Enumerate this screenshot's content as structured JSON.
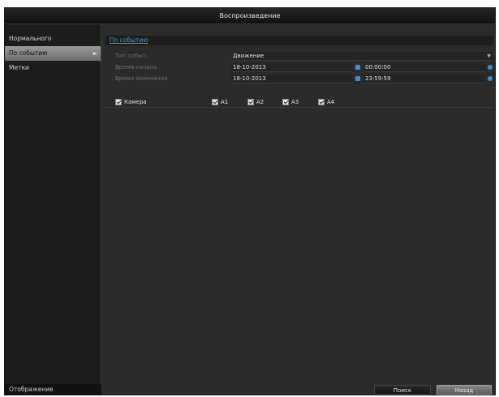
{
  "window": {
    "title": "Воспроизведение"
  },
  "sidebar": {
    "items": [
      {
        "label": "Нормального"
      },
      {
        "label": "По событию",
        "arrow": "►"
      },
      {
        "label": "Метки"
      }
    ],
    "footer": "Отображение"
  },
  "section": {
    "tab": "По событию"
  },
  "form": {
    "event_type": {
      "label": "Тип событ.",
      "value": "Движение",
      "arrow": "▼"
    },
    "start_time": {
      "label": "Время начала",
      "date": "18-10-2013",
      "time": "00:00:00"
    },
    "end_time": {
      "label": "Время окончания",
      "date": "18-10-2013",
      "time": "23:59:59"
    }
  },
  "channels": {
    "label": "Камера",
    "items": [
      "A1",
      "A2",
      "A3",
      "A4"
    ]
  },
  "buttons": {
    "search": "Поиск",
    "back": "Назад"
  },
  "colors": {
    "accent": "#2ba3e0",
    "icon_blue": "#3d8fd6",
    "panel": "#2b2b2b"
  }
}
